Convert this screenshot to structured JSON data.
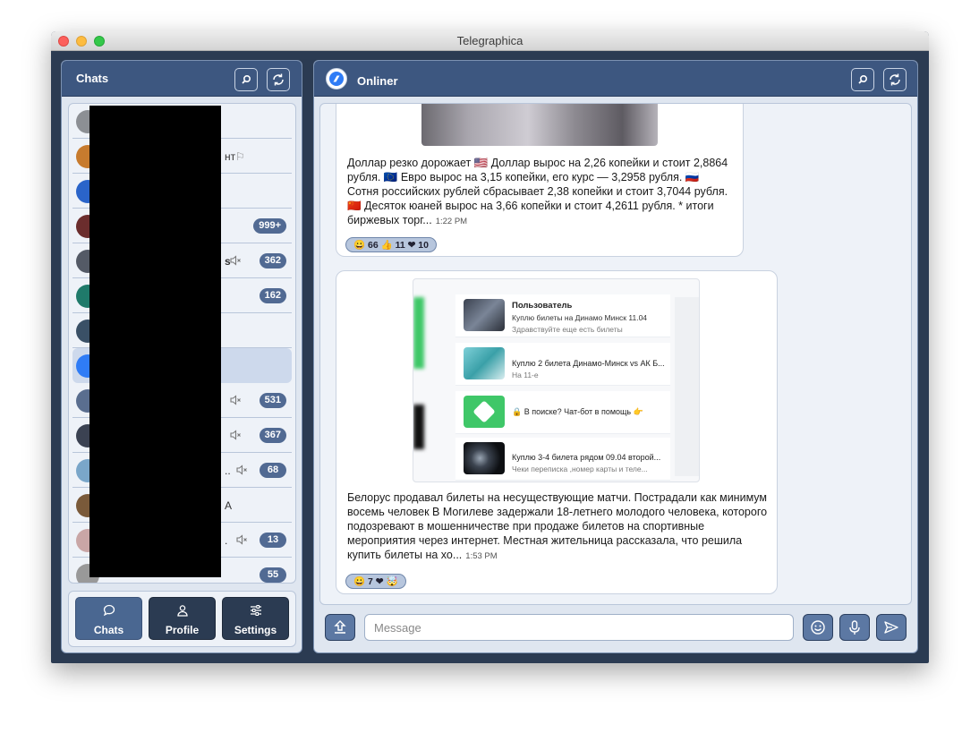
{
  "window": {
    "title": "Telegraphica"
  },
  "left_panel": {
    "title": "Chats",
    "chats": [
      {
        "name": "",
        "badge": "",
        "muted": false
      },
      {
        "name": "нт",
        "badge": "",
        "muted": false,
        "flag": true
      },
      {
        "name": "",
        "badge": "",
        "muted": false
      },
      {
        "name": "",
        "badge": "999+",
        "muted": false
      },
      {
        "name": "s",
        "badge": "362",
        "muted": true,
        "bold": true
      },
      {
        "name": "",
        "badge": "162",
        "muted": false
      },
      {
        "name": "",
        "badge": "",
        "muted": false
      },
      {
        "name": "",
        "badge": "",
        "muted": false,
        "active": true
      },
      {
        "name": "",
        "badge": "531",
        "muted": true
      },
      {
        "name": "",
        "badge": "367",
        "muted": true
      },
      {
        "name": "..",
        "badge": "68",
        "muted": true
      },
      {
        "name": "А",
        "badge": "",
        "muted": false
      },
      {
        "name": ".",
        "badge": "13",
        "muted": true
      },
      {
        "name": "",
        "badge": "55",
        "muted": false
      }
    ],
    "nav": [
      {
        "label": "Chats",
        "icon": "chat-bubble-icon",
        "active": true
      },
      {
        "label": "Profile",
        "icon": "person-icon",
        "active": false
      },
      {
        "label": "Settings",
        "icon": "sliders-icon",
        "active": false
      }
    ]
  },
  "right_panel": {
    "chat_title": "Onliner",
    "messages": [
      {
        "text": "Доллар резко дорожает 🇺🇸 Доллар вырос на 2,26 копейки и стоит 2,8864 рубля. 🇪🇺 Евро вырос на 3,15 копейки, его курс — 3,2958 рубля. 🇷🇺 Сотня российских рублей сбрасывает 2,38 копейки и стоит 3,7044 рубля. 🇨🇳 Десяток юаней вырос на 3,66 копейки и стоит 4,2611 рубля. * итоги биржевых торг...",
        "time": "1:22 PM",
        "reactions": "😀 66  👍 11  ❤ 10"
      },
      {
        "text": "Белорус продавал билеты на несуществующие матчи. Пострадали как минимум восемь человек В Могилеве задержали 18-летнего молодого человека, которого подозревают в мошенничестве при продаже билетов на спортивные мероприятия через интернет. Местная жительница рассказала, что решила купить билеты на хо...",
        "time": "1:53 PM",
        "reactions": "😀 7  ❤  🤯",
        "screenshot": {
          "items": [
            {
              "title": "Пользователь",
              "line1": "Куплю билеты на Динамо Минск 11.04",
              "line2": "Здравствуйте еще есть билеты"
            },
            {
              "title": "",
              "line1": "Куплю 2 билета Динамо-Минск vs АК Б...",
              "line2": "На 11-е"
            },
            {
              "title": "",
              "line1": "🔒 В поиске? Чат-бот в помощь 👉",
              "line2": ""
            },
            {
              "title": "",
              "line1": "Куплю 3-4 билета рядом 09.04 второй...",
              "line2": "Чеки переписка ,номер карты и теле..."
            }
          ]
        }
      }
    ],
    "composer": {
      "placeholder": "Message"
    }
  },
  "colors": {
    "header": "#3d5780",
    "window": "#2b3b52",
    "badge": "#516a93",
    "accent_active": "#4a6791"
  }
}
